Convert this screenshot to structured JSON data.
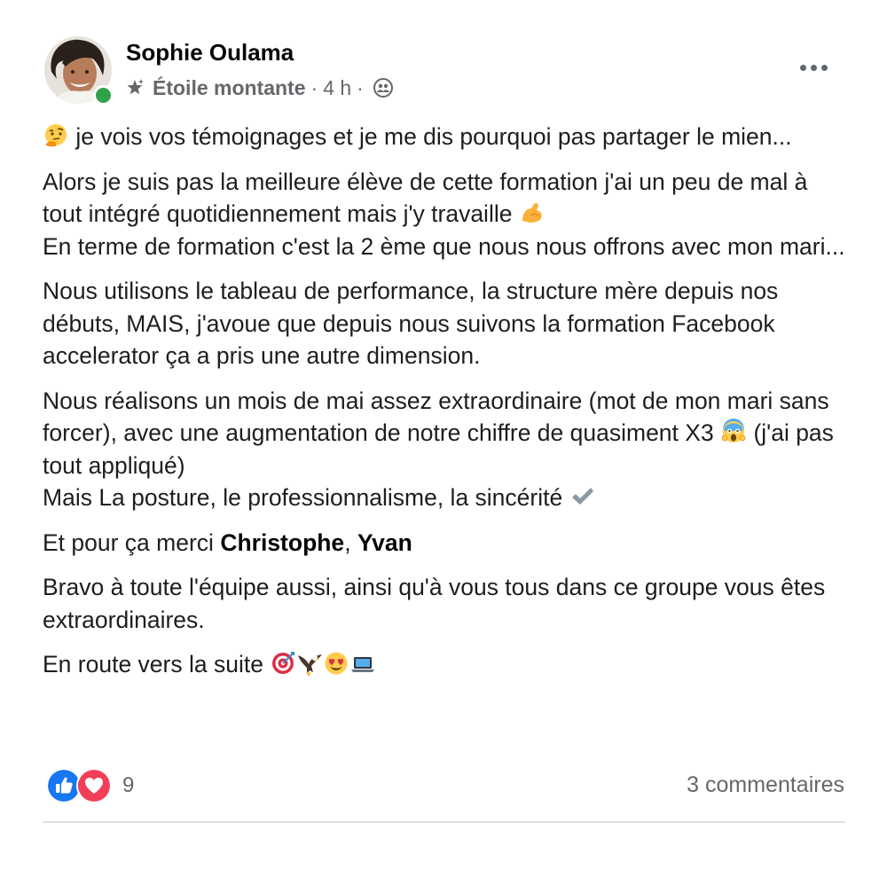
{
  "post": {
    "author": {
      "name": "Sophie Oulama",
      "online": true
    },
    "meta": {
      "badge": "Étoile montante",
      "separator": "·",
      "time": "4 h",
      "audience_icon": "group-icon"
    },
    "more_icon": "more-options-icon",
    "body": {
      "p1": "je vois vos témoignages et je me dis pourquoi pas partager le mien...",
      "p1_emoji": "thinking-face-emoji",
      "p2_line1": "Alors je suis pas la meilleure élève de cette formation j'ai un peu de mal à tout intégré quotidiennement mais j'y travaille",
      "p2_emoji": "flexed-biceps-emoji",
      "p2_line2": "En terme de formation c'est la 2 ème que nous nous offrons avec mon mari...",
      "p3": "Nous utilisons le tableau de performance, la structure mère depuis nos débuts, MAIS, j'avoue que depuis nous suivons la formation Facebook accelerator ça a pris une autre dimension.",
      "p4_line1a": "Nous réalisons un mois de mai assez extraordinaire (mot de mon mari sans forcer), avec une augmentation de notre chiffre de quasiment X3",
      "p4_emoji1": "screaming-face-emoji",
      "p4_line1b": "(j'ai pas tout appliqué)",
      "p4_line2": "Mais La posture, le professionnalisme, la sincérité",
      "p4_emoji2": "check-mark-emoji",
      "p5_prefix": "Et pour ça merci",
      "p5_mention1": "Christophe",
      "p5_comma": ",",
      "p5_mention2": "Yvan",
      "p6": "Bravo à toute l'équipe aussi, ainsi qu'à vous tous dans ce groupe vous êtes extraordinaires.",
      "p7": "En route vers la suite",
      "p7_emojis": [
        "direct-hit-emoji",
        "eagle-emoji",
        "heart-eyes-emoji",
        "laptop-emoji"
      ]
    },
    "reactions": {
      "types": [
        "like-icon",
        "love-icon"
      ],
      "count": "9"
    },
    "comments": "3 commentaires",
    "colors": {
      "like": "#1877f2",
      "love": "#f33e58",
      "online": "#31a24c",
      "secondary_text": "#65676b"
    }
  }
}
